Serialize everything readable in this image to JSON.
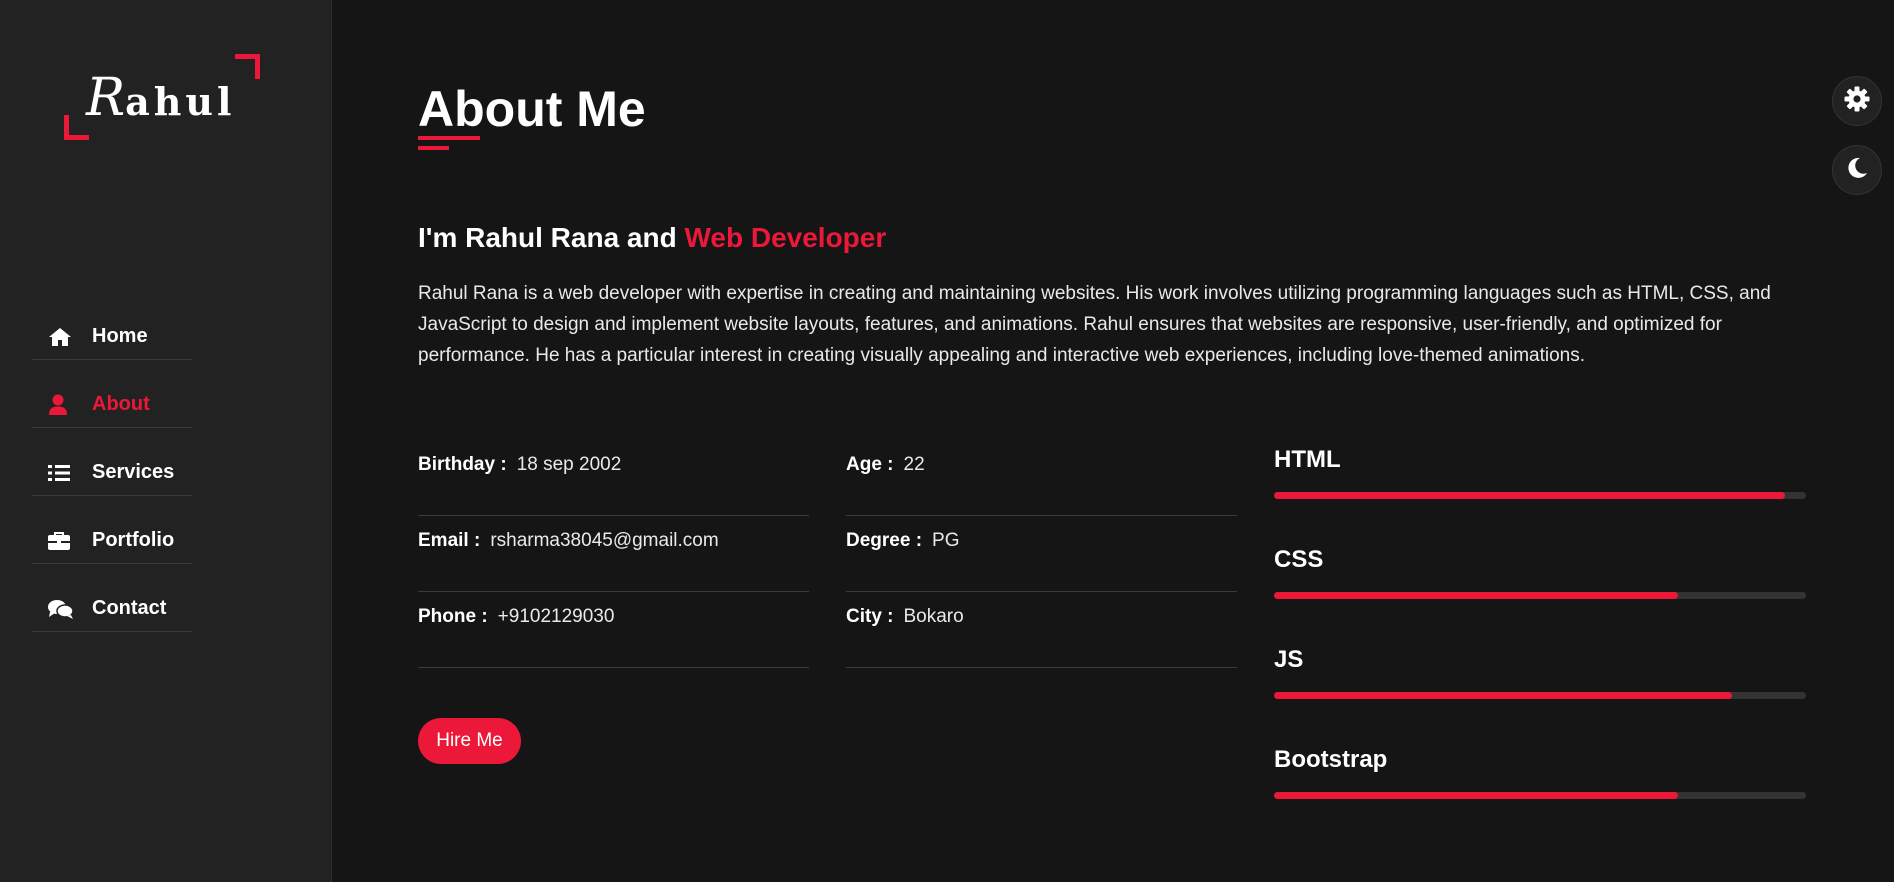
{
  "logo": {
    "first_letter": "R",
    "rest": "ahul"
  },
  "nav": {
    "items": [
      {
        "label": "Home",
        "icon": "home-icon"
      },
      {
        "label": "About",
        "icon": "user-icon",
        "active": true
      },
      {
        "label": "Services",
        "icon": "list-icon"
      },
      {
        "label": "Portfolio",
        "icon": "briefcase-icon"
      },
      {
        "label": "Contact",
        "icon": "comments-icon"
      }
    ]
  },
  "about": {
    "title": "About Me",
    "headline_prefix": "I'm Rahul Rana and ",
    "headline_role": "Web Developer",
    "bio": "Rahul Rana is a web developer with expertise in creating and maintaining websites. His work involves utilizing programming languages such as HTML, CSS, and JavaScript to design and implement website layouts, features, and animations. Rahul ensures that websites are responsive, user-friendly, and optimized for performance. He has a particular interest in creating visually appealing and interactive web experiences, including love-themed animations.",
    "info_left": [
      {
        "label": "Birthday :",
        "value": "18 sep 2002"
      },
      {
        "label": "Email :",
        "value": "rsharma38045@gmail.com"
      },
      {
        "label": "Phone :",
        "value": "+9102129030"
      }
    ],
    "info_right": [
      {
        "label": "Age :",
        "value": "22"
      },
      {
        "label": "Degree :",
        "value": "PG"
      },
      {
        "label": "City :",
        "value": "Bokaro"
      }
    ],
    "hire_label": "Hire Me"
  },
  "skills": [
    {
      "name": "HTML",
      "level": 96
    },
    {
      "name": "CSS",
      "level": 76
    },
    {
      "name": "JS",
      "level": 86
    },
    {
      "name": "Bootstrap",
      "level": 76
    }
  ],
  "colors": {
    "accent": "#ec1839",
    "background": "#151515",
    "sidebar": "#222222"
  }
}
